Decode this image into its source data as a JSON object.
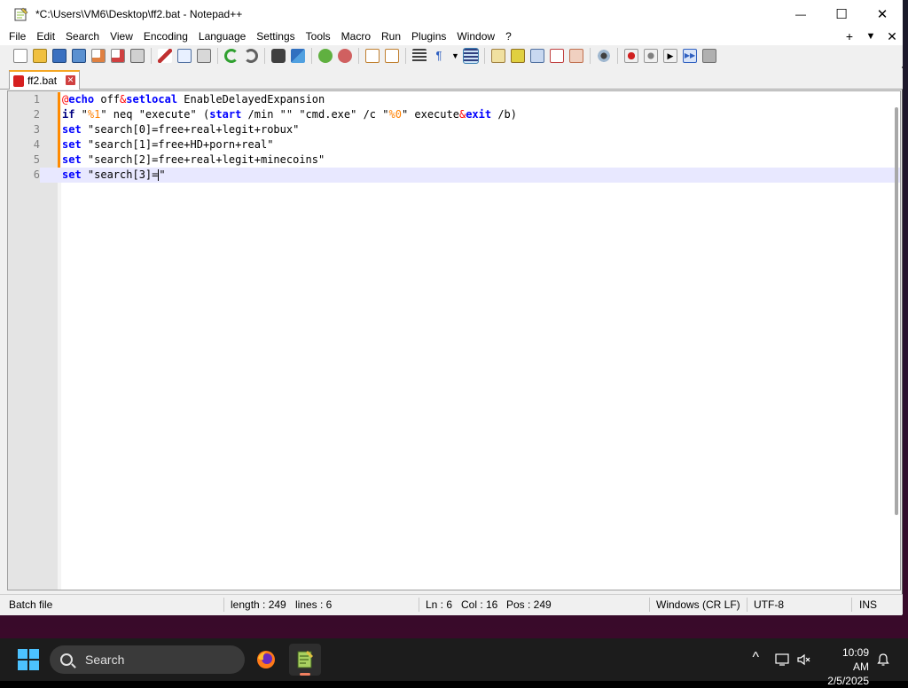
{
  "window": {
    "title": "*C:\\Users\\VM6\\Desktop\\ff2.bat - Notepad++",
    "minimize": "—",
    "maximize": "☐",
    "close": "✕"
  },
  "menu": {
    "items": [
      "File",
      "Edit",
      "Search",
      "View",
      "Encoding",
      "Language",
      "Settings",
      "Tools",
      "Macro",
      "Run",
      "Plugins",
      "Window",
      "?"
    ],
    "right_plus": "+",
    "right_dropdown": "▼",
    "right_close": "✕"
  },
  "toolbar": {
    "icons": [
      "new-file-icon",
      "open-file-icon",
      "save-icon",
      "save-all-icon",
      "close-icon",
      "close-all-icon",
      "print-icon",
      "cut-icon",
      "copy-icon",
      "paste-icon",
      "undo-icon",
      "redo-icon",
      "find-icon",
      "replace-icon",
      "zoom-in-icon",
      "zoom-out-icon",
      "sync-vertical-icon",
      "sync-horizontal-icon",
      "word-wrap-icon",
      "show-all-chars-icon",
      "indent-guide-icon",
      "doc-map-icon",
      "function-list-icon",
      "folder-workspace-icon",
      "monitoring-icon",
      "record-macro-icon",
      "stop-record-icon",
      "play-macro-icon",
      "run-macro-multiple-icon",
      "save-macro-icon"
    ]
  },
  "tabs": [
    {
      "label": "ff2.bat",
      "close": "✕"
    }
  ],
  "editor": {
    "lines": [
      {
        "num": "1",
        "tokens": [
          [
            "at",
            "@"
          ],
          [
            "kw",
            "echo"
          ],
          [
            "plain",
            " off"
          ],
          [
            "op",
            "&"
          ],
          [
            "kw",
            "setlocal"
          ],
          [
            "plain",
            " EnableDelayedExpansion"
          ]
        ]
      },
      {
        "num": "2",
        "tokens": [
          [
            "kw2",
            "if"
          ],
          [
            "plain",
            " \""
          ],
          [
            "var",
            "%1"
          ],
          [
            "plain",
            "\" neq \"execute\" ("
          ],
          [
            "kw",
            "start"
          ],
          [
            "plain",
            " /min \"\" \"cmd.exe\" /c \""
          ],
          [
            "var",
            "%0"
          ],
          [
            "plain",
            "\" execute"
          ],
          [
            "op",
            "&"
          ],
          [
            "kw",
            "exit"
          ],
          [
            "plain",
            " /b)"
          ]
        ]
      },
      {
        "num": "3",
        "tokens": [
          [
            "kw",
            "set"
          ],
          [
            "plain",
            " \"search[0]=free+real+legit+robux\""
          ]
        ]
      },
      {
        "num": "4",
        "tokens": [
          [
            "kw",
            "set"
          ],
          [
            "plain",
            " \"search[1]=free+HD+porn+real\""
          ]
        ]
      },
      {
        "num": "5",
        "tokens": [
          [
            "kw",
            "set"
          ],
          [
            "plain",
            " \"search[2]=free+real+legit+minecoins\""
          ]
        ]
      },
      {
        "num": "6",
        "tokens": [
          [
            "kw",
            "set"
          ],
          [
            "plain",
            " \"search[3]=\""
          ]
        ],
        "current": true
      }
    ]
  },
  "status": {
    "language": "Batch file",
    "length": "length : 249",
    "lines": "lines : 6",
    "ln": "Ln : 6",
    "col": "Col : 16",
    "pos": "Pos : 249",
    "eol": "Windows (CR LF)",
    "encoding": "UTF-8",
    "mode": "INS"
  },
  "taskbar": {
    "search_placeholder": "Search",
    "tray_chevron": "^",
    "time": "10:09 AM",
    "date": "2/5/2025"
  },
  "colors": {
    "accent_orange": "#f5a623",
    "keyword_blue": "#0000ff",
    "variable_orange": "#ff8000",
    "operator_red": "#ff0000"
  }
}
